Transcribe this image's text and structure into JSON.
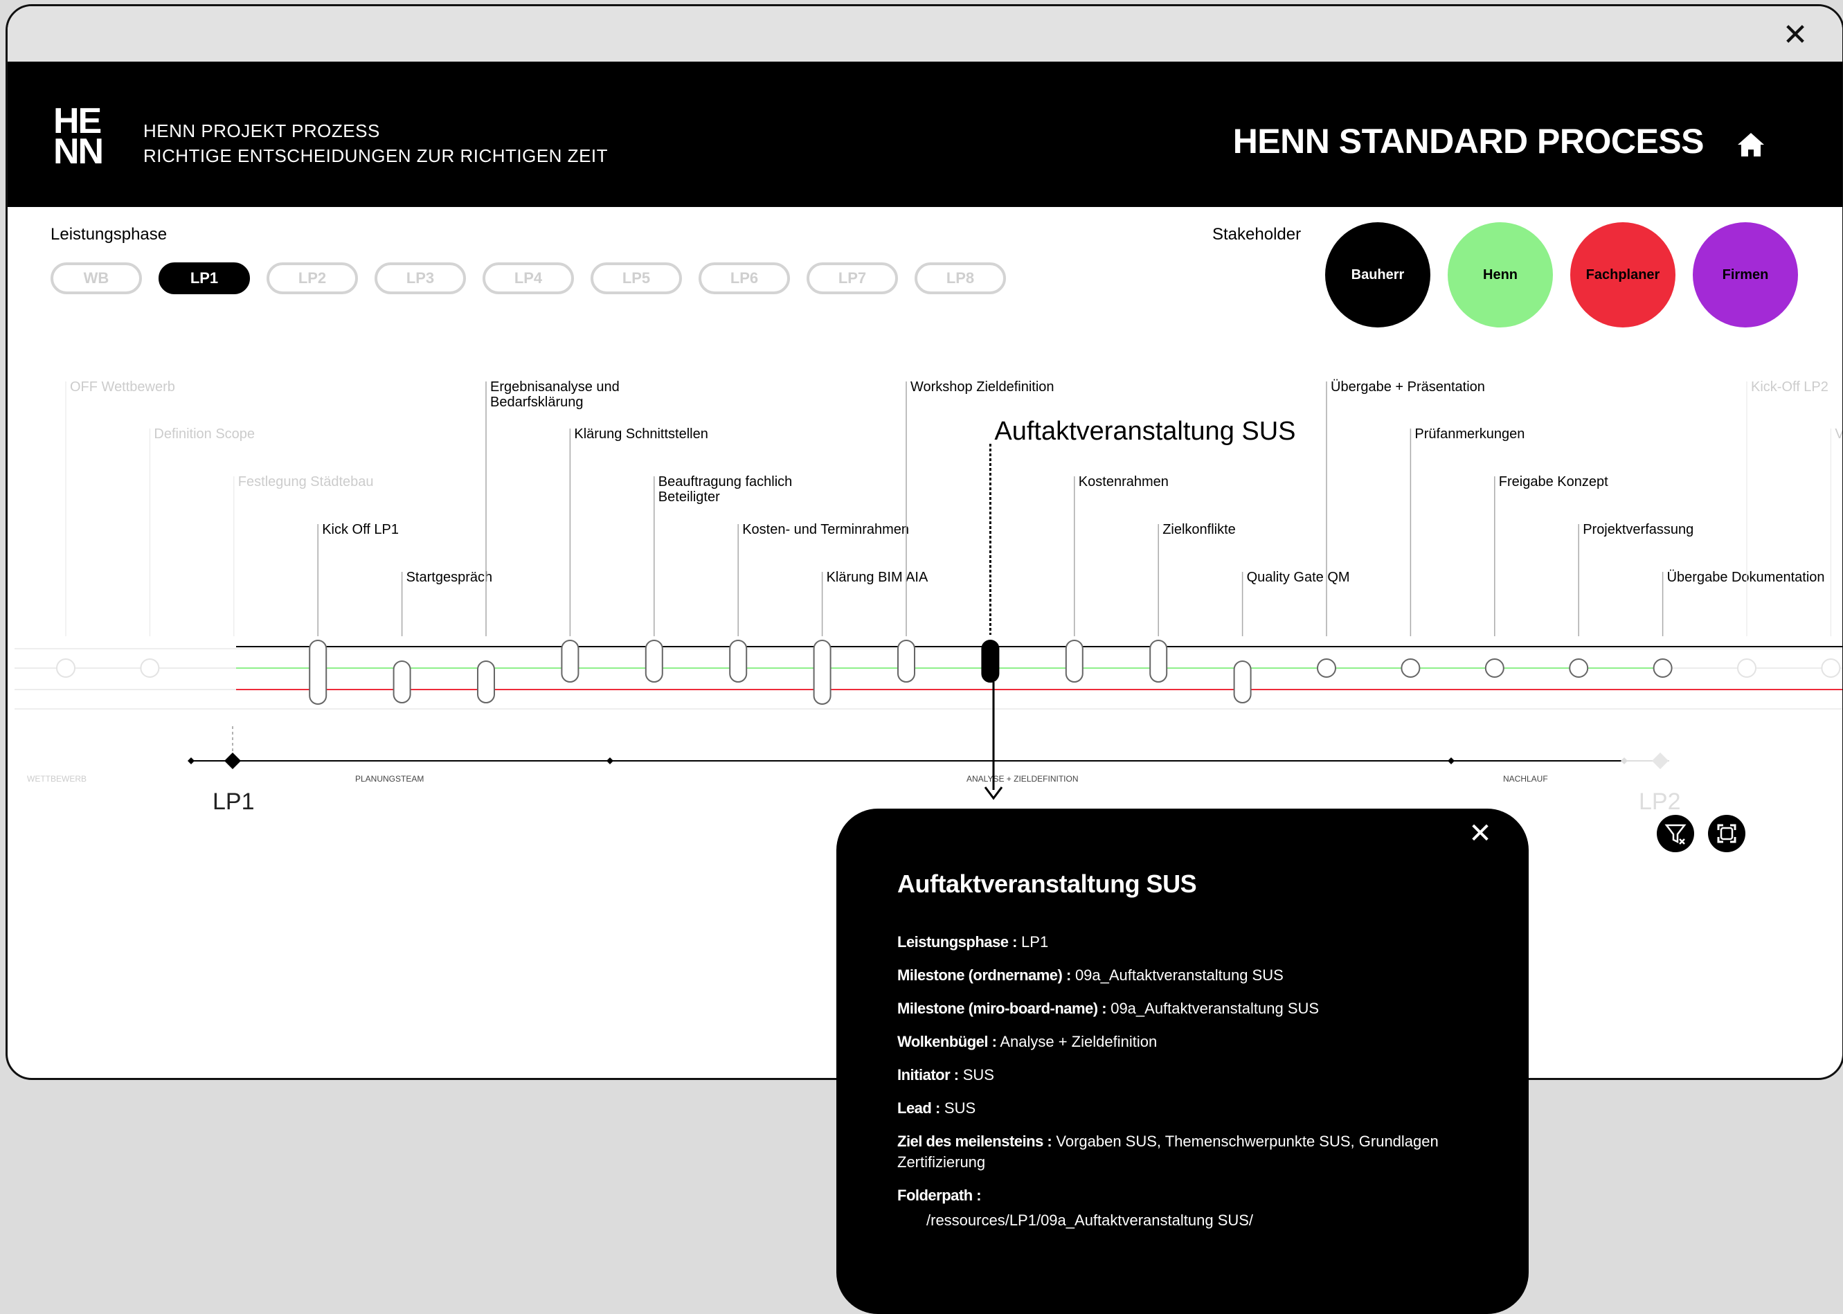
{
  "window": {
    "close_icon": "close-icon"
  },
  "header": {
    "logo_line1": "HE",
    "logo_line2": "NN",
    "tagline_1": "HENN PROJEKT PROZESS",
    "tagline_2": "RICHTIGE ENTSCHEIDUNGEN ZUR RICHTIGEN ZEIT",
    "title": "HENN STANDARD PROCESS",
    "home_icon": "home-icon"
  },
  "phases": {
    "label": "Leistungsphase",
    "active": "LP1",
    "items": [
      "WB",
      "LP1",
      "LP2",
      "LP3",
      "LP4",
      "LP5",
      "LP6",
      "LP7",
      "LP8"
    ]
  },
  "stakeholders": {
    "label": "Stakeholder",
    "items": [
      {
        "label": "Bauherr",
        "color": "#000000",
        "text_color": "#ffffff"
      },
      {
        "label": "Henn",
        "color": "#8ef08a",
        "text_color": "#000000"
      },
      {
        "label": "Fachplaner",
        "color": "#ee2b3a",
        "text_color": "#000000"
      },
      {
        "label": "Firmen",
        "color": "#a32ad6",
        "text_color": "#000000"
      }
    ]
  },
  "timeline": {
    "milestones": [
      {
        "label": "OFF Wettbewerb",
        "faded": true,
        "tier": 0,
        "shape": "circle"
      },
      {
        "label": "Definition Scope",
        "faded": true,
        "tier": 1,
        "shape": "circle"
      },
      {
        "label": "Festlegung Städtebau",
        "faded": true,
        "tier": 2,
        "shape": "none"
      },
      {
        "label": "Kick Off LP1",
        "faded": false,
        "tier": 3,
        "shape": "pill-tall"
      },
      {
        "label": "Startgespräch",
        "faded": false,
        "tier": 4,
        "shape": "pill-low"
      },
      {
        "label": "Ergebnisanalyse und Bedarfsklärung",
        "faded": false,
        "tier": 0,
        "shape": "pill-low"
      },
      {
        "label": "Klärung Schnittstellen",
        "faded": false,
        "tier": 1,
        "shape": "pill-high"
      },
      {
        "label": "Beauftragung fachlich Beteiligter",
        "faded": false,
        "tier": 2,
        "shape": "pill-high"
      },
      {
        "label": "Kosten- und Terminrahmen",
        "faded": false,
        "tier": 3,
        "shape": "pill-high"
      },
      {
        "label": "Klärung BIM AIA",
        "faded": false,
        "tier": 4,
        "shape": "pill-tall"
      },
      {
        "label": "Workshop Zieldefinition",
        "faded": false,
        "tier": 0,
        "shape": "pill-high"
      },
      {
        "label": "Auftaktveranstaltung SUS",
        "faded": false,
        "tier": 1,
        "shape": "selected"
      },
      {
        "label": "Kostenrahmen",
        "faded": false,
        "tier": 2,
        "shape": "pill-high"
      },
      {
        "label": "Zielkonflikte",
        "faded": false,
        "tier": 3,
        "shape": "pill-high"
      },
      {
        "label": "Quality Gate QM",
        "faded": false,
        "tier": 4,
        "shape": "pill-low"
      },
      {
        "label": "Übergabe + Präsentation",
        "faded": false,
        "tier": 0,
        "shape": "circle"
      },
      {
        "label": "Prüfanmerkungen",
        "faded": false,
        "tier": 1,
        "shape": "circle"
      },
      {
        "label": "Freigabe Konzept",
        "faded": false,
        "tier": 2,
        "shape": "circle"
      },
      {
        "label": "Projektverfassung",
        "faded": false,
        "tier": 3,
        "shape": "circle"
      },
      {
        "label": "Übergabe Dokumentation",
        "faded": false,
        "tier": 4,
        "shape": "circle"
      },
      {
        "label": "Kick-Off LP2",
        "faded": true,
        "tier": 0,
        "shape": "circle"
      },
      {
        "label": "Vereinbarung",
        "faded": true,
        "tier": 1,
        "shape": "circle"
      }
    ],
    "phase_sections": [
      "WETTBEWERB",
      "PLANUNGSTEAM",
      "ANALYSE + ZIELDEFINITION",
      "NACHLAUF"
    ],
    "lp_current": "LP1",
    "lp_next": "LP2",
    "line_colors": {
      "bauherr": "#000000",
      "henn": "#8ef08a",
      "fachplaner": "#ee2b3a"
    },
    "filter_icon": "filter-clear-icon",
    "fullscreen_icon": "fullscreen-icon"
  },
  "popup": {
    "title": "Auftaktveranstaltung SUS",
    "close_icon": "close-icon",
    "fields": [
      {
        "key": "Leistungsphase :",
        "value": "LP1"
      },
      {
        "key": "Milestone (ordnername) :",
        "value": "09a_Auftaktveranstaltung SUS"
      },
      {
        "key": "Milestone (miro-board-name) :",
        "value": "09a_Auftaktveranstaltung SUS"
      },
      {
        "key": "Wolkenbügel :",
        "value": "Analyse + Zieldefinition"
      },
      {
        "key": "Initiator :",
        "value": "SUS"
      },
      {
        "key": "Lead :",
        "value": "SUS"
      },
      {
        "key": "Ziel des meilensteins :",
        "value": "Vorgaben SUS, Themenschwerpunkte SUS, Grundlagen Zertifizierung"
      }
    ],
    "folder_key": "Folderpath :",
    "folder_value": "/ressources/LP1/09a_Auftaktveranstaltung SUS/"
  }
}
